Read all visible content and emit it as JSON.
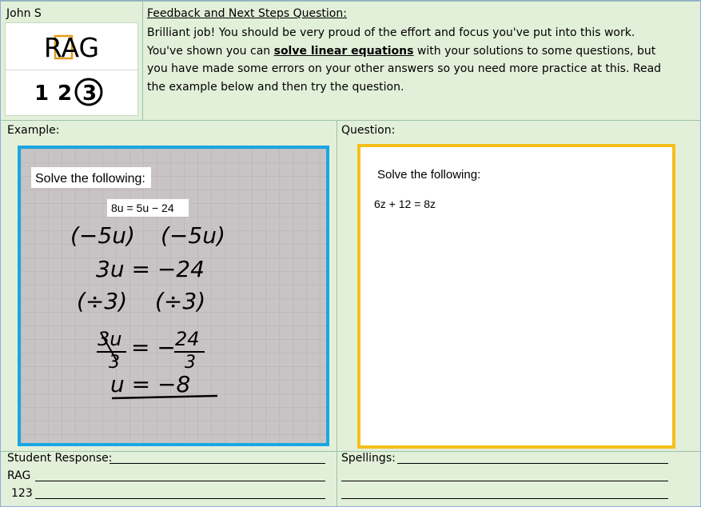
{
  "student_name": "John S",
  "rag_logo": "RAG",
  "rag_digits": [
    "1",
    "2",
    "3"
  ],
  "feedback": {
    "heading": "Feedback and Next Steps Question:",
    "text_before": "Brilliant job! You should be very proud of the effort and focus you've put into this work. You've shown you can ",
    "highlight": "solve linear equations",
    "text_after": " with your solutions to some questions, but you have made some errors on your other answers so you need more practice at this. Read the example below and then try the question."
  },
  "example": {
    "label": "Example:",
    "instruction": "Solve the following:",
    "equation": "8u = 5u − 24",
    "working": [
      "(−5u)",
      "(−5u)",
      "3u = −24",
      "(÷3)",
      "(÷3)",
      "3u",
      "3",
      "= −",
      "24",
      "3",
      "u = −8"
    ]
  },
  "question": {
    "label": "Question:",
    "instruction": "Solve the following:",
    "equation": "6z + 12 = 8z"
  },
  "footer": {
    "student_response": "Student Response:",
    "rag": "RAG",
    "number": "123",
    "spellings": "Spellings:"
  },
  "colors": {
    "example_border": "#19a7e3",
    "question_border": "#f5bf1a",
    "background": "#e2efd9"
  }
}
